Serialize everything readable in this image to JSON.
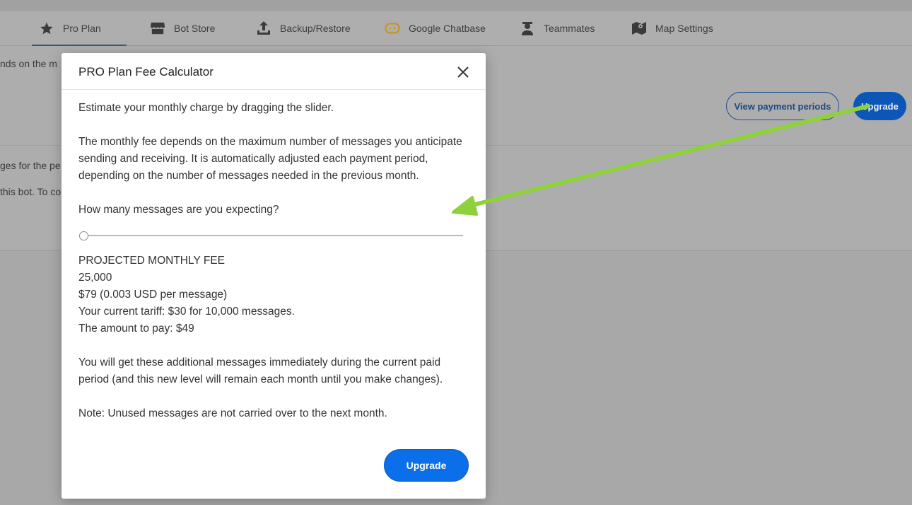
{
  "tabs": [
    {
      "label": "Pro Plan",
      "icon": "star-icon",
      "active": true
    },
    {
      "label": "Bot Store",
      "icon": "store-icon",
      "active": false
    },
    {
      "label": "Backup/Restore",
      "icon": "upload-icon",
      "active": false
    },
    {
      "label": "Google Chatbase",
      "icon": "chatbase-icon",
      "active": false
    },
    {
      "label": "Teammates",
      "icon": "teammate-icon",
      "active": false
    },
    {
      "label": "Map Settings",
      "icon": "map-icon",
      "active": false
    }
  ],
  "background": {
    "text_1": "nds on the m",
    "text_2": "ges for the pe",
    "text_3": "this bot. To co",
    "view_payment_label": "View payment periods",
    "upgrade_label": "Upgrade"
  },
  "modal": {
    "title": "PRO Plan Fee Calculator",
    "intro": "Estimate your monthly charge by dragging the slider.",
    "description": "The monthly fee depends on the maximum number of messages you anticipate sending and receiving. It is automatically adjusted each payment period, depending on the number of messages needed in the previous month.",
    "question": "How many messages are you expecting?",
    "slider_value": 0,
    "projected_label": "PROJECTED MONTHLY FEE",
    "messages": "25,000",
    "price": "$79 (0.003 USD per message)",
    "current_tariff": "Your current tariff: $30 for 10,000 messages.",
    "amount_to_pay": "The amount to pay: $49",
    "additional_info": "You will get these additional messages immediately during the current paid period (and this new level will remain each month until you make changes).",
    "note": "Note: Unused messages are not carried over to the next month.",
    "upgrade_label": "Upgrade"
  },
  "colors": {
    "primary": "#0a6fe8",
    "annotation_arrow": "#8fd13d"
  }
}
